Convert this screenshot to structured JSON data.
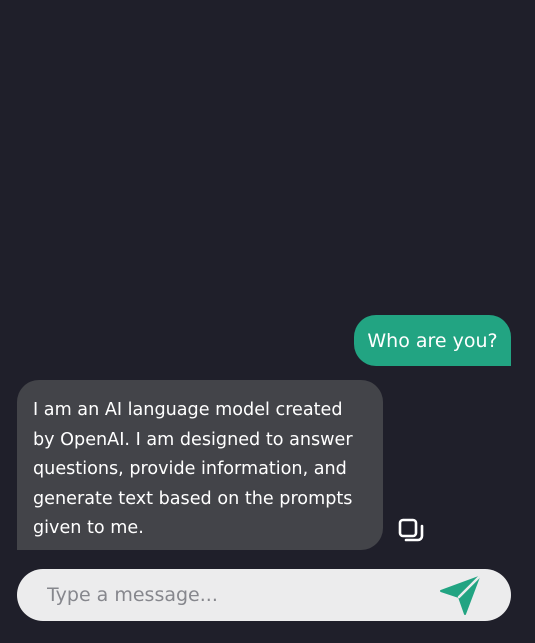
{
  "messages": [
    {
      "role": "user",
      "text": "Who are you?"
    },
    {
      "role": "assistant",
      "text": "I am an AI language model created by OpenAI. I am designed to answer questions, provide information, and generate text based on the prompts given to me."
    }
  ],
  "composer": {
    "placeholder": "Type a message..."
  },
  "icons": {
    "copy": "copy-icon",
    "send": "send-icon"
  },
  "colors": {
    "background": "#1f1f2a",
    "user_bubble": "#22a482",
    "assistant_bubble": "#434449",
    "input_bg": "#ececed",
    "send_icon": "#22a482"
  }
}
